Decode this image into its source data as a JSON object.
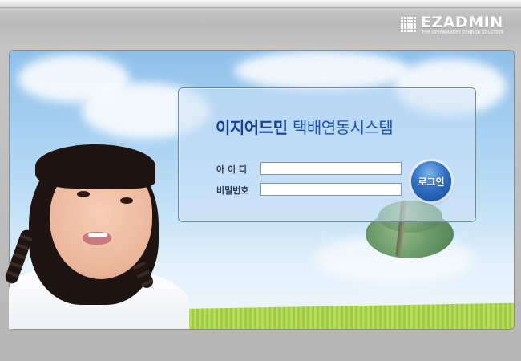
{
  "header": {
    "logo_text": "EZADMIN",
    "logo_tagline": "THE OPENMARKET VENDOR SOLUTION"
  },
  "login_panel": {
    "title_part1": "이지어드민",
    "title_part2": "택배연동시스템",
    "id_label": "아 이 디",
    "password_label": "비밀번호",
    "id_value": "",
    "password_value": "",
    "login_button": "로그인"
  },
  "colors": {
    "title": "#163e9a",
    "login_button": "#2f6fc4",
    "background": "#c0c0c0"
  }
}
